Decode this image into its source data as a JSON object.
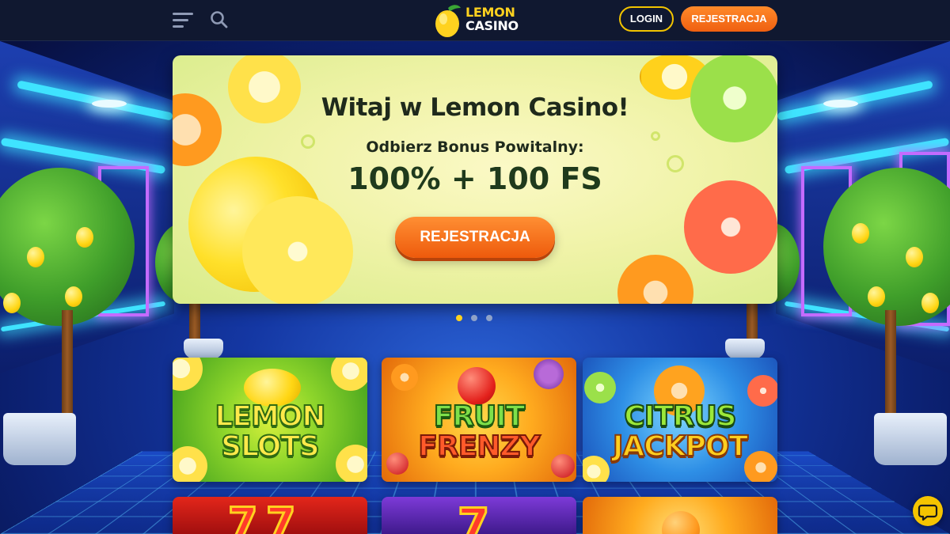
{
  "header": {
    "logo": {
      "line1": "LEMON",
      "line2": "CASINO"
    },
    "login_label": "LOGIN",
    "register_label": "REJESTRACJA",
    "menu_icon": "hamburger-menu-icon",
    "search_icon": "search-icon"
  },
  "hero": {
    "title": "Witaj w Lemon Casino!",
    "subtitle": "Odbierz Bonus Powitalny:",
    "bonus": "100% + 100 FS",
    "cta_label": "REJESTRACJA",
    "slides": {
      "count": 3,
      "active": 1
    }
  },
  "games": [
    {
      "line1": "LEMON",
      "line2": "SLOTS"
    },
    {
      "line1": "FRUIT",
      "line2": "FRENZY"
    },
    {
      "line1": "CITRUS",
      "line2": "JACKPOT"
    }
  ],
  "colors": {
    "header_bg": "#101830",
    "accent_yellow": "#ffd21f",
    "accent_orange": "#ef5f10",
    "login_border": "#f2c400"
  },
  "chat": {
    "icon": "chat-bubble-icon"
  }
}
